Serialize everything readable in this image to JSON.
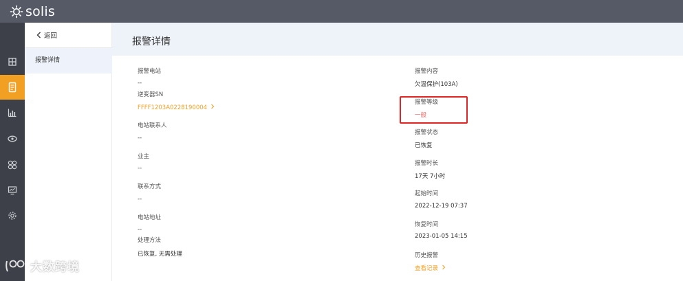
{
  "brand": {
    "name": "solis"
  },
  "rail": {
    "icons": [
      "building-icon",
      "document-icon",
      "bar-chart-icon",
      "eye-icon",
      "fan-icon",
      "monitor-icon",
      "settings-icon"
    ],
    "active_index": 1
  },
  "subnav": {
    "back_label": "返回",
    "item_label": "报警详情"
  },
  "page": {
    "title": "报警详情"
  },
  "left_fields": {
    "station_label": "报警电站",
    "station_value": "--",
    "sn_label": "逆变器SN",
    "sn_value": "FFFF1203A0228190004",
    "contact_label": "电站联系人",
    "contact_value": "--",
    "owner_label": "业主",
    "owner_value": "--",
    "phone_label": "联系方式",
    "phone_value": "--",
    "address_label": "电站地址",
    "address_value": "--",
    "method_label": "处理方法",
    "method_value": "已恢复, 无需处理"
  },
  "right_fields": {
    "content_label": "报警内容",
    "content_value": "欠温保护(103A)",
    "level_label": "报警等级",
    "level_value": "一般",
    "status_label": "报警状态",
    "status_value": "已恢复",
    "duration_label": "报警时长",
    "duration_value": "17天 7小时",
    "start_label": "起始时间",
    "start_value": "2022-12-19 07:37",
    "recover_label": "恢复时间",
    "recover_value": "2023-01-05 14:15",
    "history_label": "历史报警",
    "history_link": "查看记录"
  },
  "watermark": {
    "text": "大数跨境"
  },
  "colors": {
    "accent": "#f2a024",
    "highlight": "#e02424",
    "level": "#ec6b6b"
  }
}
